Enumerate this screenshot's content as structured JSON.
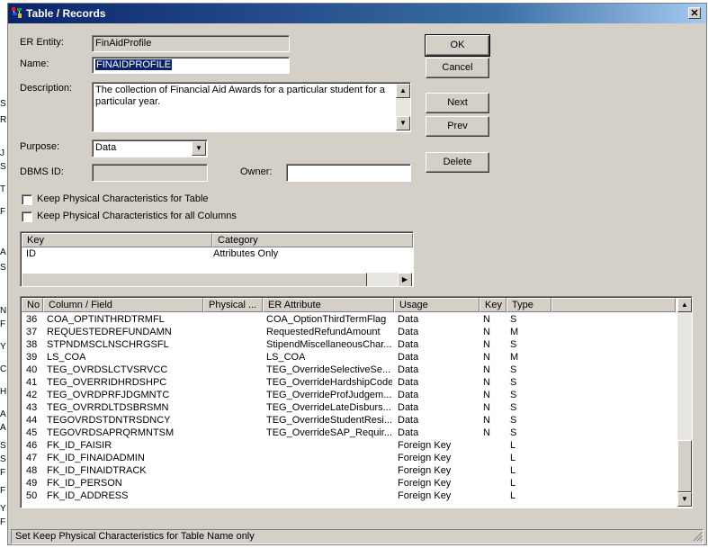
{
  "window": {
    "title": "Table / Records",
    "close_glyph": "✕"
  },
  "background_fragments": [
    "S",
    "R",
    "J",
    "S",
    "T",
    "F",
    "A",
    "S",
    "N",
    "F",
    "Y",
    "C",
    "H",
    "A",
    "A",
    "S",
    "S",
    "F",
    "F",
    "Y",
    "F"
  ],
  "form": {
    "er_entity_label": "ER Entity:",
    "er_entity_value": "FinAidProfile",
    "name_label": "Name:",
    "name_value": "FINAIDPROFILE",
    "description_label": "Description:",
    "description_value": "The collection of Financial Aid Awards for a particular student for a particular year.",
    "purpose_label": "Purpose:",
    "purpose_value": "Data",
    "dbms_id_label": "DBMS ID:",
    "dbms_id_value": "",
    "owner_label": "Owner:",
    "owner_value": "",
    "keep_table_label": "Keep Physical Characteristics for Table",
    "keep_table_checked": false,
    "keep_columns_label": "Keep Physical Characteristics for all Columns",
    "keep_columns_checked": false
  },
  "buttons": {
    "ok": "OK",
    "cancel": "Cancel",
    "next": "Next",
    "prev": "Prev",
    "delete": "Delete"
  },
  "keys_table": {
    "headers": [
      "Key",
      "Category"
    ],
    "rows": [
      {
        "key": "ID",
        "category": "Attributes Only"
      }
    ]
  },
  "columns_table": {
    "headers": [
      "No",
      "Column / Field",
      "Physical ...",
      "ER Attribute",
      "Usage",
      "Key",
      "Type"
    ],
    "rows": [
      {
        "no": "36",
        "column": "COA_OPTINTHRDTRMFL",
        "physical": "",
        "er_attr": "COA_OptionThirdTermFlag",
        "usage": "Data",
        "key": "N",
        "type": "S"
      },
      {
        "no": "37",
        "column": "REQUESTEDREFUNDAMN",
        "physical": "",
        "er_attr": "RequestedRefundAmount",
        "usage": "Data",
        "key": "N",
        "type": "M"
      },
      {
        "no": "38",
        "column": "STPNDMSCLNSCHRGSFL",
        "physical": "",
        "er_attr": "StipendMiscellaneousChar...",
        "usage": "Data",
        "key": "N",
        "type": "S"
      },
      {
        "no": "39",
        "column": "LS_COA",
        "physical": "",
        "er_attr": "LS_COA",
        "usage": "Data",
        "key": "N",
        "type": "M"
      },
      {
        "no": "40",
        "column": "TEG_OVRDSLCTVSRVCC",
        "physical": "",
        "er_attr": "TEG_OverrideSelectiveSe...",
        "usage": "Data",
        "key": "N",
        "type": "S"
      },
      {
        "no": "41",
        "column": "TEG_OVERRIDHRDSHPC",
        "physical": "",
        "er_attr": "TEG_OverrideHardshipCode",
        "usage": "Data",
        "key": "N",
        "type": "S"
      },
      {
        "no": "42",
        "column": "TEG_OVRDPRFJDGMNTC",
        "physical": "",
        "er_attr": "TEG_OverrideProfJudgem...",
        "usage": "Data",
        "key": "N",
        "type": "S"
      },
      {
        "no": "43",
        "column": "TEG_OVRRDLTDSBRSMN",
        "physical": "",
        "er_attr": "TEG_OverrideLateDisburs...",
        "usage": "Data",
        "key": "N",
        "type": "S"
      },
      {
        "no": "44",
        "column": "TEGOVRDSTDNTRSDNCY",
        "physical": "",
        "er_attr": "TEG_OverrideStudentResi...",
        "usage": "Data",
        "key": "N",
        "type": "S"
      },
      {
        "no": "45",
        "column": "TEGOVRDSAPRQRMNTSM",
        "physical": "",
        "er_attr": "TEG_OverrideSAP_Requir...",
        "usage": "Data",
        "key": "N",
        "type": "S"
      },
      {
        "no": "46",
        "column": "FK_ID_FAISIR",
        "physical": "",
        "er_attr": "",
        "usage": "Foreign Key",
        "key": "",
        "type": "L"
      },
      {
        "no": "47",
        "column": "FK_ID_FINAIDADMIN",
        "physical": "",
        "er_attr": "",
        "usage": "Foreign Key",
        "key": "",
        "type": "L"
      },
      {
        "no": "48",
        "column": "FK_ID_FINAIDTRACK",
        "physical": "",
        "er_attr": "",
        "usage": "Foreign Key",
        "key": "",
        "type": "L"
      },
      {
        "no": "49",
        "column": "FK_ID_PERSON",
        "physical": "",
        "er_attr": "",
        "usage": "Foreign Key",
        "key": "",
        "type": "L"
      },
      {
        "no": "50",
        "column": "FK_ID_ADDRESS",
        "physical": "",
        "er_attr": "",
        "usage": "Foreign Key",
        "key": "",
        "type": "L"
      }
    ]
  },
  "status_bar": {
    "text": "Set Keep Physical Characteristics for Table Name only"
  }
}
